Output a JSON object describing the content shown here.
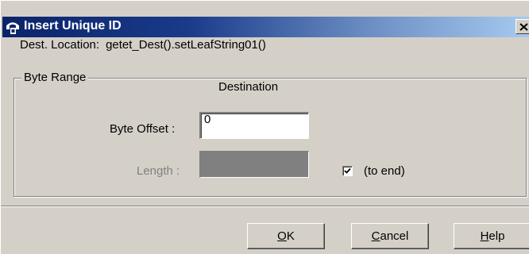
{
  "window": {
    "title": "Insert Unique ID",
    "close_glyph": "✕"
  },
  "dest_location": {
    "label": "Dest. Location:",
    "value": "getet_Dest().setLeafString01()"
  },
  "byte_range": {
    "group_label": "Byte Range",
    "column_header": "Destination",
    "byte_offset": {
      "label": "Byte Offset  :",
      "value": "0"
    },
    "length": {
      "label": "Length  :",
      "value": "",
      "enabled": false
    },
    "to_end": {
      "label": "(to end)",
      "checked": true
    }
  },
  "buttons": {
    "ok": {
      "mnemonic": "O",
      "rest": "K"
    },
    "cancel": {
      "mnemonic": "C",
      "rest": "ancel"
    },
    "help": {
      "mnemonic": "H",
      "rest": "elp"
    }
  },
  "colors": {
    "title_start": "#0a246a",
    "title_end": "#a6caf0",
    "dialog_face": "#d4d0c8"
  }
}
